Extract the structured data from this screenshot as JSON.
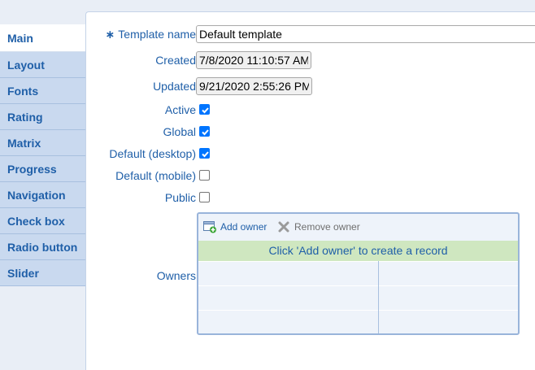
{
  "sidebar": {
    "tabs": [
      {
        "label": "Main",
        "active": true
      },
      {
        "label": "Layout"
      },
      {
        "label": "Fonts"
      },
      {
        "label": "Rating"
      },
      {
        "label": "Matrix"
      },
      {
        "label": "Progress"
      },
      {
        "label": "Navigation"
      },
      {
        "label": "Check box"
      },
      {
        "label": "Radio button"
      },
      {
        "label": "Slider"
      }
    ]
  },
  "form": {
    "template_name": {
      "label": "Template name",
      "required_marker": "∗",
      "value": "Default template"
    },
    "created": {
      "label": "Created",
      "value": "7/8/2020 11:10:57 AM"
    },
    "updated": {
      "label": "Updated",
      "value": "9/21/2020 2:55:26 PM"
    },
    "active": {
      "label": "Active",
      "checked": true
    },
    "global": {
      "label": "Global",
      "checked": true
    },
    "default_desktop": {
      "label": "Default (desktop)",
      "checked": true
    },
    "default_mobile": {
      "label": "Default (mobile)",
      "checked": false
    },
    "public": {
      "label": "Public",
      "checked": false
    },
    "owners": {
      "label": "Owners",
      "add_label": "Add owner",
      "remove_label": "Remove owner",
      "empty_message": "Click 'Add owner' to create a record"
    }
  },
  "colors": {
    "accent": "#1f5fa8",
    "tab_bg": "#c9d9ef",
    "check_blue": "#0075ff",
    "empty_green": "#cfe7c0"
  }
}
